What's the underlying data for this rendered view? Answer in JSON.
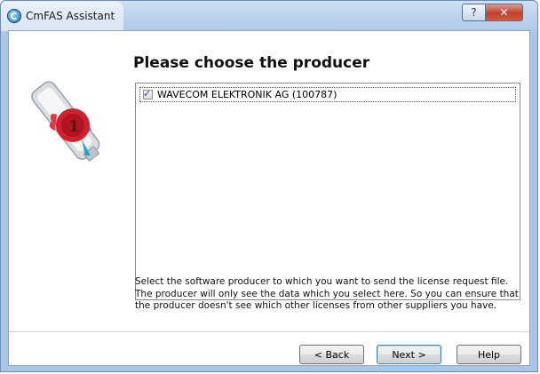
{
  "window": {
    "title": "CmFAS Assistant",
    "help_glyph": "?",
    "close_glyph": "✕"
  },
  "page": {
    "heading": "Please choose the producer",
    "producers": [
      {
        "label": "WAVECOM ELEKTRONIK AG (100787)",
        "checked": true
      }
    ],
    "description": "Select the software producer to which you want to send the license request file. The producer will only see the data which you select here. So you can ensure that the producer doesn't see which other licenses from other suppliers you have."
  },
  "buttons": {
    "back": "< Back",
    "next": "Next >",
    "help": "Help"
  },
  "icons": {
    "app": "codemeter-icon",
    "logo": "usb-dongle-wax-seal-icon"
  },
  "colors": {
    "titlebar": "#b9d1ec",
    "close": "#c0402a",
    "seal": "#d21f2b"
  }
}
